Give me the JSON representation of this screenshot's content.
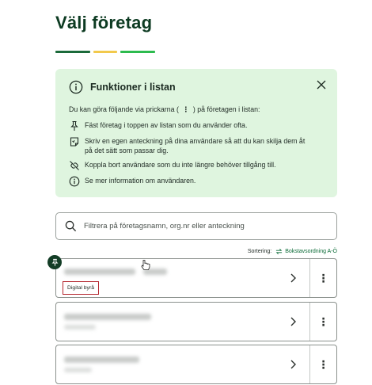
{
  "page": {
    "title": "Välj företag"
  },
  "stripes": [
    {
      "color": "#1b6a3a"
    },
    {
      "color": "#f2c94c"
    },
    {
      "color": "#2dbb4e"
    }
  ],
  "info": {
    "title": "Funktioner i listan",
    "intro_before": "Du kan göra följande via prickarna (",
    "intro_dots": "⋮",
    "intro_after": ") på företagen i listan:",
    "items": [
      {
        "icon": "pin-icon",
        "text": "Fäst företag i toppen av listan som du använder ofta."
      },
      {
        "icon": "note-icon",
        "text": "Skriv en egen anteckning på dina användare så att du kan skilja dem åt på det sätt som passar dig."
      },
      {
        "icon": "unlink-icon",
        "text": "Koppla bort användare som du inte längre behöver tillgång till."
      },
      {
        "icon": "info-icon",
        "text": "Se mer information om användaren."
      }
    ]
  },
  "search": {
    "placeholder": "Filtrera på företagsnamn, org.nr eller anteckning",
    "value": ""
  },
  "sort": {
    "label": "Sortering:",
    "value": "Bokstavsordning A-Ö"
  },
  "cards": [
    {
      "tag": "Digital byrå",
      "pinned": true
    },
    {
      "tag": ""
    },
    {
      "tag": ""
    }
  ],
  "colors": {
    "accent": "#0b6b37",
    "info_bg": "#dff5df",
    "tag_border": "#b3262e",
    "title": "#0d3b22"
  }
}
